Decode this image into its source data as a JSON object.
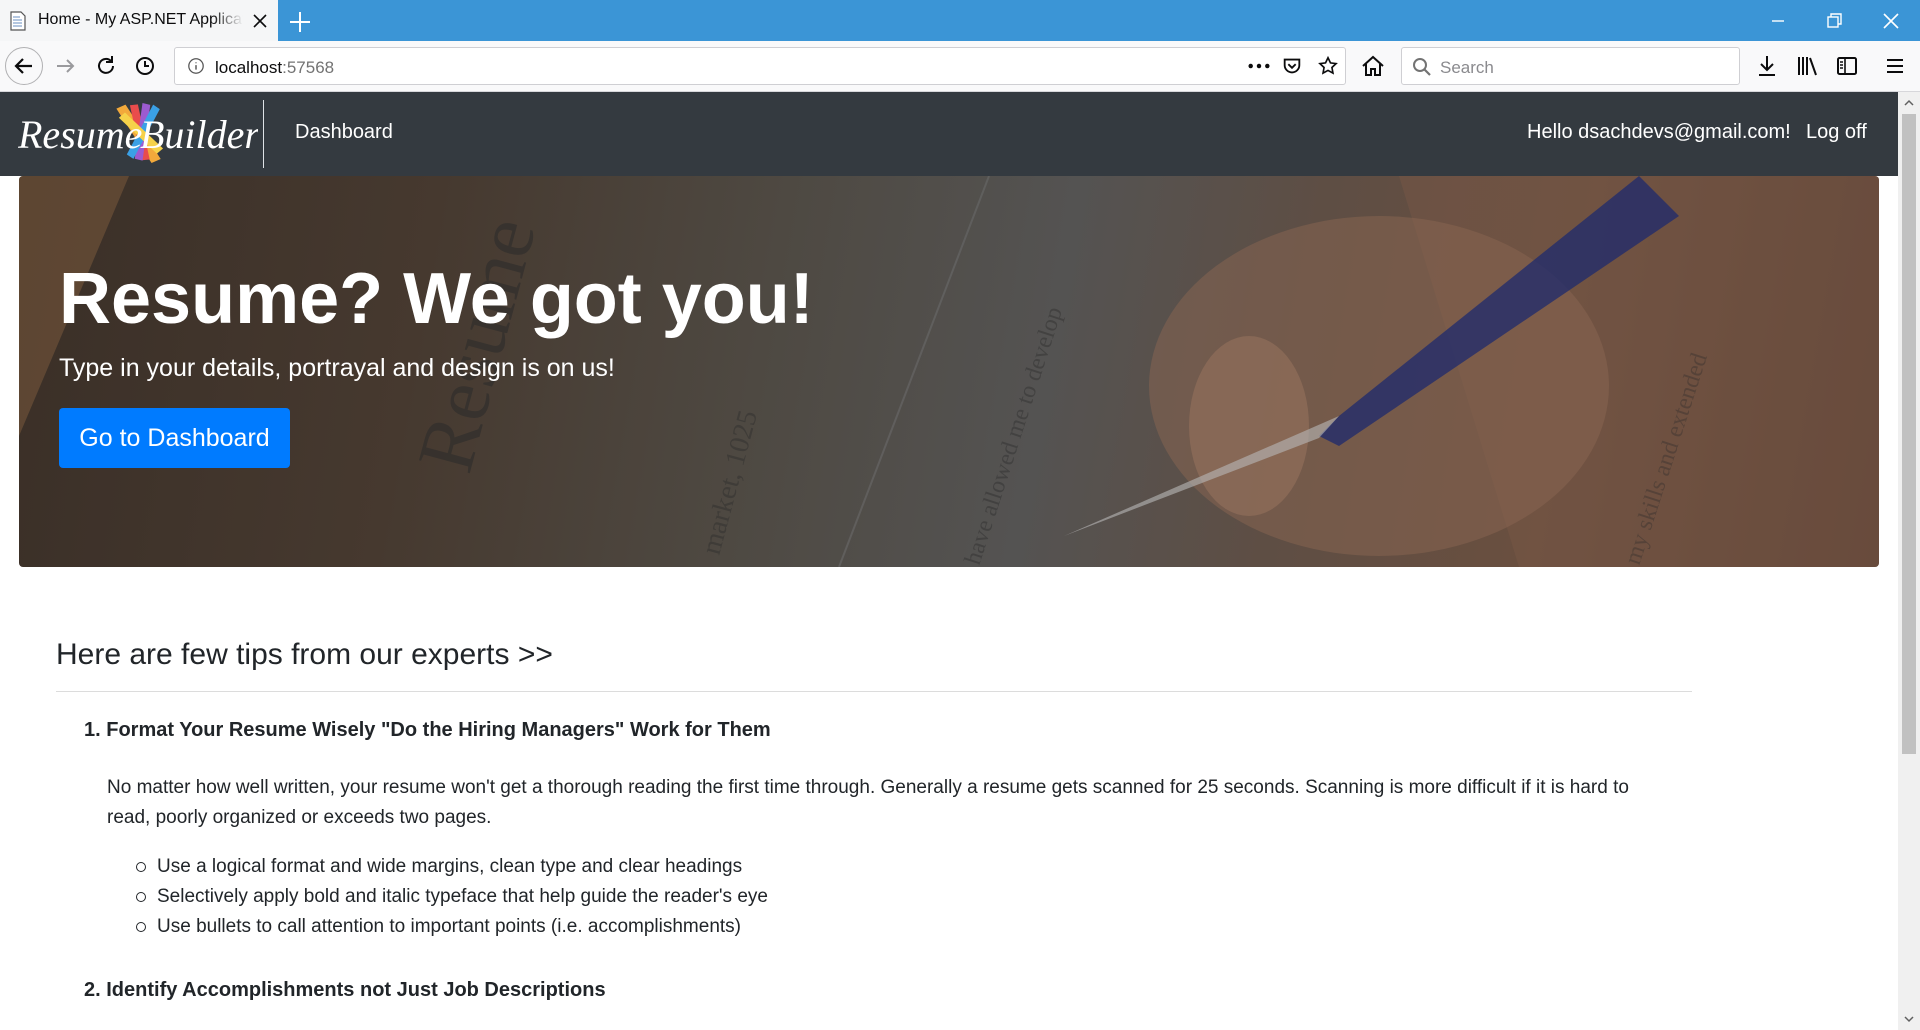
{
  "browser": {
    "tab_title": "Home - My ASP.NET Application",
    "url_host": "localhost",
    "url_port": ":57568",
    "search_placeholder": "Search",
    "icons": {
      "tab": "page-icon",
      "close": "close-icon",
      "new_tab": "plus-icon",
      "back": "back-arrow-icon",
      "forward": "forward-arrow-icon",
      "reload": "reload-icon",
      "history": "clock-icon",
      "info": "info-icon",
      "more": "ellipsis-icon",
      "pocket": "pocket-icon",
      "bookmark": "star-icon",
      "home": "home-icon",
      "download": "download-icon",
      "library": "library-icon",
      "sidebar": "sidebar-icon",
      "menu": "hamburger-icon",
      "minimize": "minimize-icon",
      "restore": "restore-icon"
    }
  },
  "site": {
    "logo_text": "Resume Builder",
    "nav": {
      "dashboard": "Dashboard",
      "greeting": "Hello dsachdevs@gmail.com!",
      "logoff": "Log off"
    },
    "nav_bg": "#343a40"
  },
  "hero": {
    "title": "Resume? We got you!",
    "subtitle": "Type in your details, portrayal and design is on us!",
    "button": "Go to Dashboard",
    "button_color": "#007bff"
  },
  "tips": {
    "heading": "Here are few tips from our experts >>",
    "items": [
      {
        "title": "1. Format Your Resume Wisely \"Do the Hiring Managers\" Work for Them",
        "body": "No matter how well written, your resume won't get a thorough reading the first time through. Generally a resume gets scanned for 25 seconds. Scanning is more difficult if it is hard to read, poorly organized or exceeds two pages.",
        "bullets": [
          "Use a logical format and wide margins, clean type and clear headings",
          "Selectively apply bold and italic typeface that help guide the reader's eye",
          "Use bullets to call attention to important points (i.e. accomplishments)"
        ]
      },
      {
        "title": "2. Identify Accomplishments not Just Job Descriptions"
      }
    ]
  }
}
